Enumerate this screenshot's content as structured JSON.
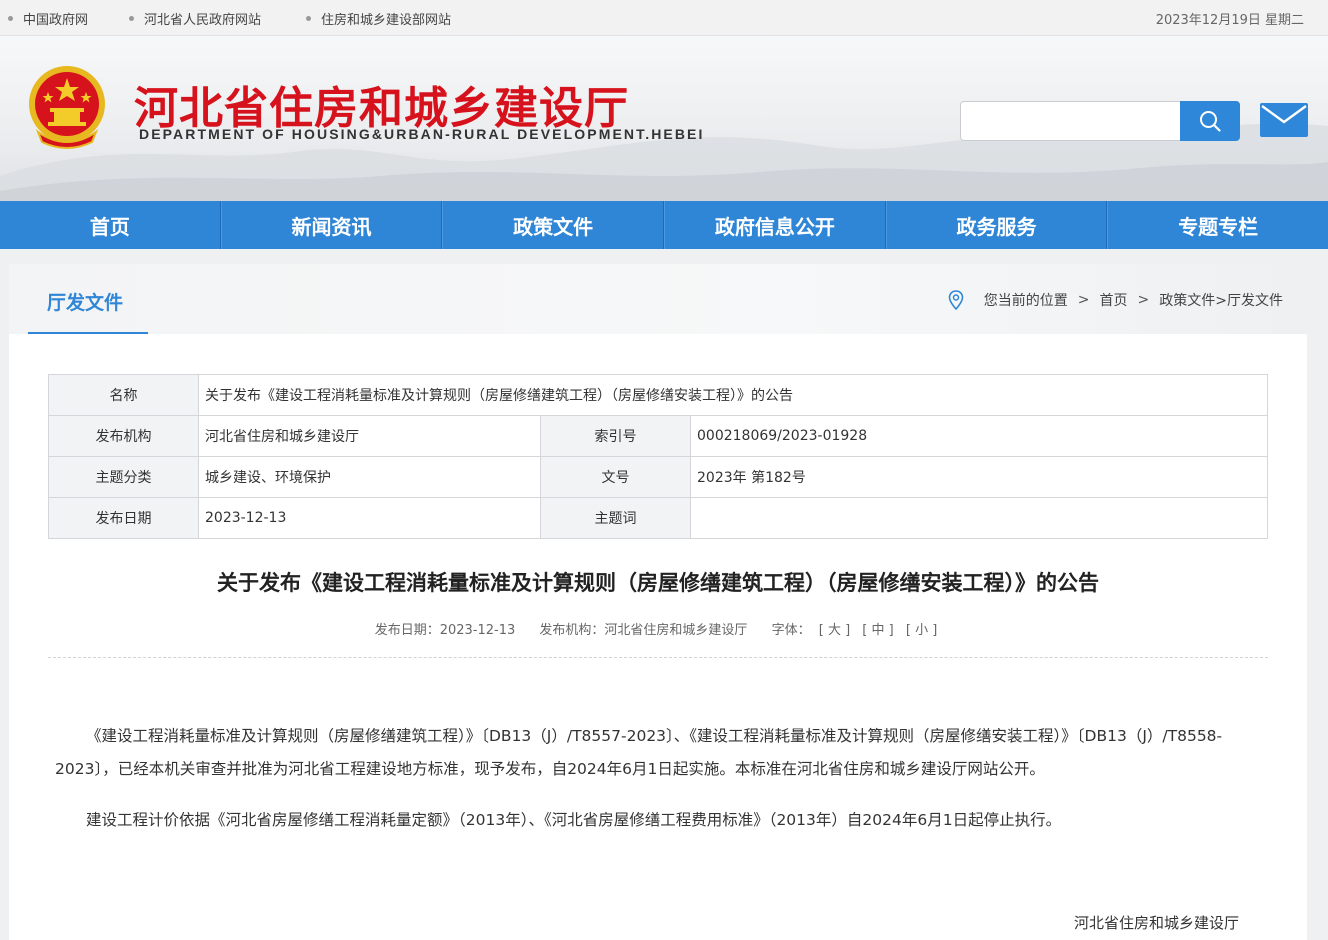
{
  "topbar": {
    "links": [
      "中国政府网",
      "河北省人民政府网站",
      "住房和城乡建设部网站"
    ],
    "date": "2023年12月19日 星期二"
  },
  "header": {
    "title_cn": "河北省住房和城乡建设厅",
    "title_en": "DEPARTMENT OF HOUSING&URBAN-RURAL DEVELOPMENT.HEBEI",
    "search_placeholder": ""
  },
  "nav": [
    "首页",
    "新闻资讯",
    "政策文件",
    "政府信息公开",
    "政务服务",
    "专题专栏"
  ],
  "section": {
    "title": "厅发文件",
    "breadcrumb": {
      "prefix": "您当前的位置",
      "home": "首页",
      "path": "政策文件>厅发文件"
    }
  },
  "info": {
    "name_label": "名称",
    "name_value": "关于发布《建设工程消耗量标准及计算规则（房屋修缮建筑工程）（房屋修缮安装工程）》的公告",
    "org_label": "发布机构",
    "org_value": "河北省住房和城乡建设厅",
    "index_label": "索引号",
    "index_value": "000218069/2023-01928",
    "topic_label": "主题分类",
    "topic_value": "城乡建设、环境保护",
    "docno_label": "文号",
    "docno_value": "2023年 第182号",
    "date_label": "发布日期",
    "date_value": "2023-12-13",
    "keyword_label": "主题词",
    "keyword_value": ""
  },
  "article": {
    "title": "关于发布《建设工程消耗量标准及计算规则（房屋修缮建筑工程）（房屋修缮安装工程）》的公告",
    "meta_date": "发布日期：2023-12-13",
    "meta_org": "发布机构：河北省住房和城乡建设厅",
    "font_label": "字体：",
    "font_large": "[ 大 ]",
    "font_medium": "[ 中 ]",
    "font_small": "[ 小 ]",
    "para1": "《建设工程消耗量标准及计算规则（房屋修缮建筑工程）》〔DB13（J）/T8557-2023〕、《建设工程消耗量标准及计算规则（房屋修缮安装工程）》〔DB13（J）/T8558-2023〕，已经本机关审查并批准为河北省工程建设地方标准，现予发布，自2024年6月1日起实施。本标准在河北省住房和城乡建设厅网站公开。",
    "para2": "建设工程计价依据《河北省房屋修缮工程消耗量定额》（2013年）、《河北省房屋修缮工程费用标准》（2013年）自2024年6月1日起停止执行。",
    "signature": "河北省住房和城乡建设厅"
  },
  "colors": {
    "brand_red": "#d6121d",
    "nav_blue": "#2f86d6",
    "search_blue": "#2e87d9"
  },
  "icons": [
    "national-emblem-icon",
    "search-icon",
    "mail-icon",
    "location-pin-icon"
  ]
}
